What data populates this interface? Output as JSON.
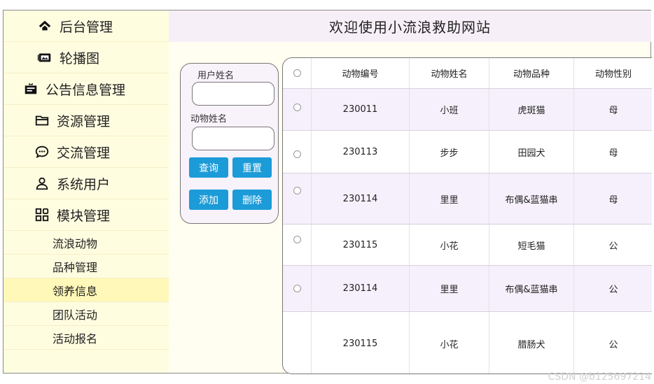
{
  "header": {
    "title": "欢迎使用小流浪救助网站"
  },
  "sidebar": {
    "items": [
      {
        "label": "后台管理",
        "icon": "home-icon"
      },
      {
        "label": "轮播图",
        "icon": "image-icon"
      },
      {
        "label": "公告信息管理",
        "icon": "notice-icon"
      },
      {
        "label": "资源管理",
        "icon": "folder-icon"
      },
      {
        "label": "交流管理",
        "icon": "chat-icon"
      },
      {
        "label": "系统用户",
        "icon": "user-icon"
      },
      {
        "label": "模块管理",
        "icon": "grid-icon"
      }
    ],
    "sub_items": [
      {
        "label": "流浪动物"
      },
      {
        "label": "品种管理"
      },
      {
        "label": "领养信息",
        "active": true
      },
      {
        "label": "团队活动"
      },
      {
        "label": "活动报名"
      }
    ]
  },
  "search": {
    "user_label": "用户姓名",
    "animal_label": "动物姓名",
    "query_label": "查询",
    "reset_label": "重置",
    "add_label": "添加",
    "delete_label": "删除"
  },
  "table": {
    "headers": [
      "动物编号",
      "动物姓名",
      "动物品种",
      "动物性别"
    ],
    "rows": [
      {
        "id": "230011",
        "name": "小班",
        "breed": "虎斑猫",
        "gender": "母"
      },
      {
        "id": "230113",
        "name": "步步",
        "breed": "田园犬",
        "gender": "母"
      },
      {
        "id": "230114",
        "name": "里里",
        "breed": "布偶&蓝猫串",
        "gender": "母"
      },
      {
        "id": "230115",
        "name": "小花",
        "breed": "短毛猫",
        "gender": "公"
      },
      {
        "id": "230114",
        "name": "里里",
        "breed": "布偶&蓝猫串",
        "gender": "公"
      },
      {
        "id": "230115",
        "name": "小花",
        "breed": "腊肠犬",
        "gender": "公"
      }
    ]
  },
  "watermark": "CSDN @b125697214"
}
